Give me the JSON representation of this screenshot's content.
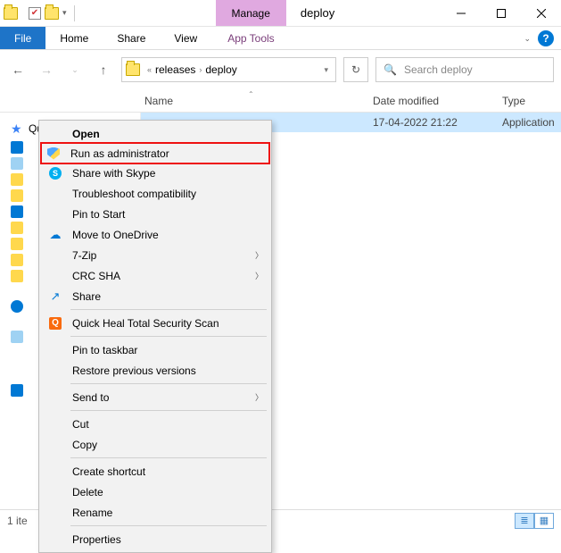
{
  "window": {
    "title": "deploy",
    "context_tab": "Manage",
    "app_tools": "App Tools"
  },
  "ribbon": {
    "file": "File",
    "tabs": [
      "Home",
      "Share",
      "View"
    ]
  },
  "breadcrumb": {
    "items": [
      "releases",
      "deploy"
    ],
    "dropdown_glyph": "▾"
  },
  "search": {
    "placeholder": "Search deploy"
  },
  "columns": {
    "name": "Name",
    "date": "Date modified",
    "type": "Type"
  },
  "sidebar": {
    "quick_access": "Quick access"
  },
  "files": [
    {
      "name": "",
      "date": "17-04-2022 21:22",
      "type": "Application"
    }
  ],
  "context_menu": {
    "open": "Open",
    "run_admin": "Run as administrator",
    "share_skype": "Share with Skype",
    "troubleshoot": "Troubleshoot compatibility",
    "pin_start": "Pin to Start",
    "onedrive": "Move to OneDrive",
    "sevenzip": "7-Zip",
    "crc": "CRC SHA",
    "share": "Share",
    "quickheal": "Quick Heal Total Security Scan",
    "pin_taskbar": "Pin to taskbar",
    "restore": "Restore previous versions",
    "sendto": "Send to",
    "cut": "Cut",
    "copy": "Copy",
    "shortcut": "Create shortcut",
    "delete": "Delete",
    "rename": "Rename",
    "properties": "Properties"
  },
  "statusbar": {
    "text": "1 ite"
  }
}
